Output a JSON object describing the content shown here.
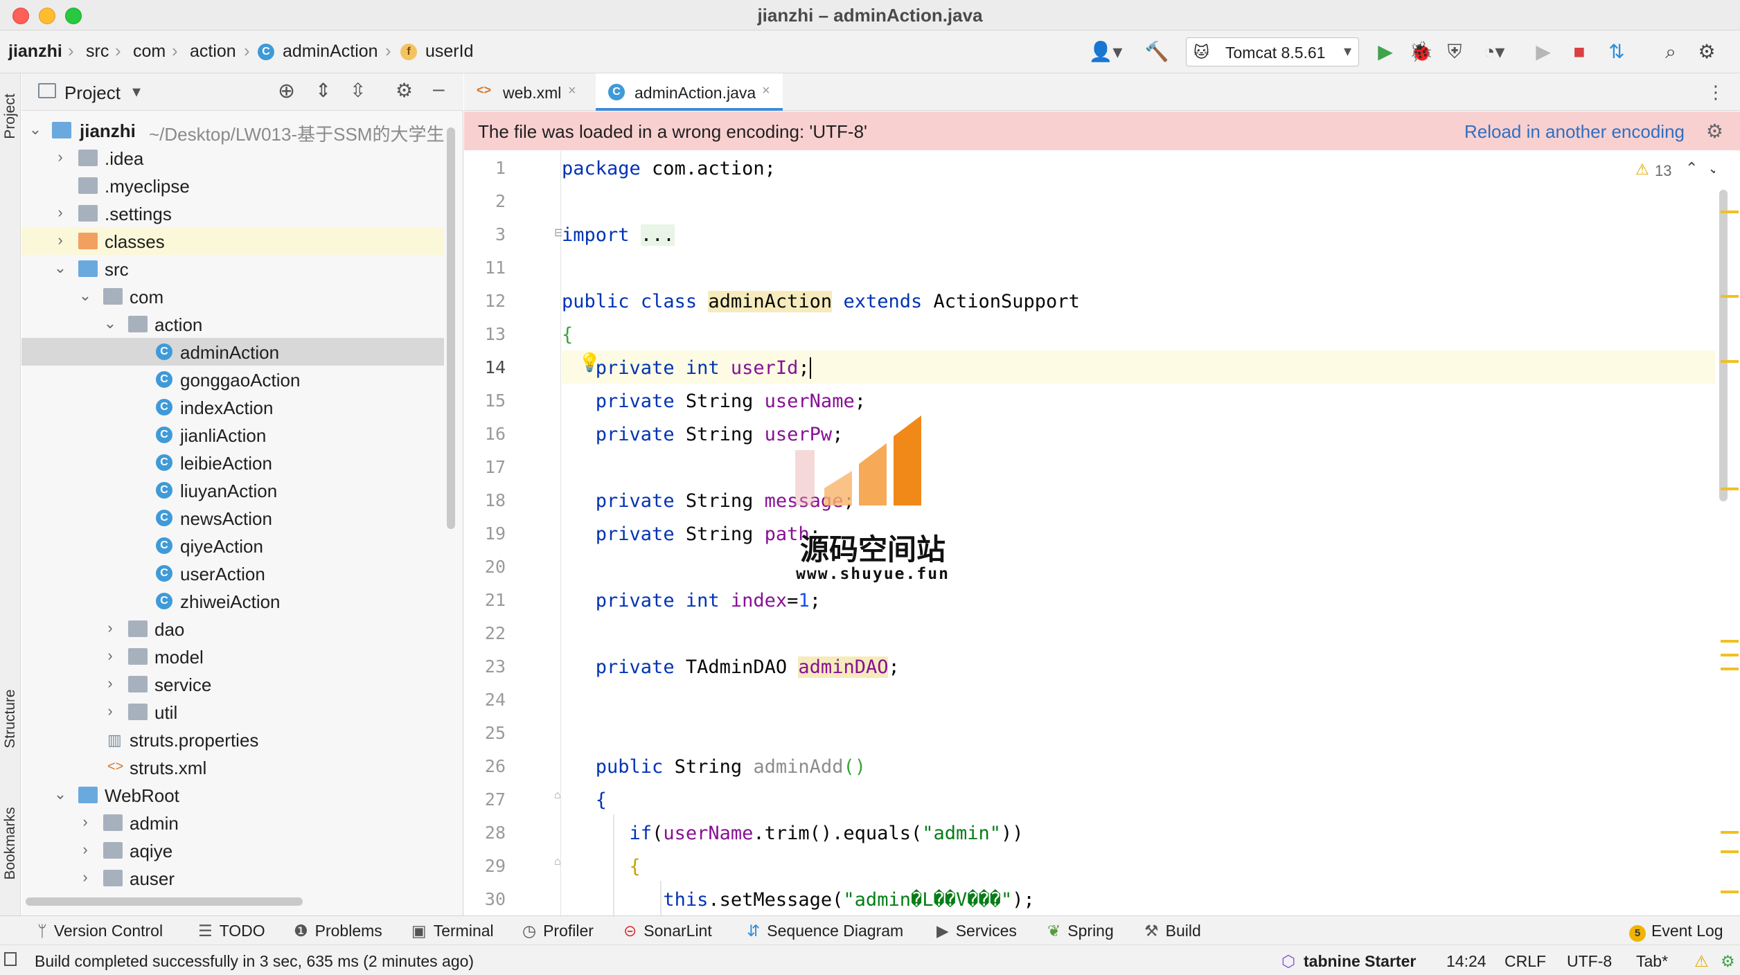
{
  "window": {
    "title": "jianzhi – adminAction.java"
  },
  "breadcrumbs": [
    {
      "label": "jianzhi"
    },
    {
      "label": "src"
    },
    {
      "label": "com"
    },
    {
      "label": "action"
    },
    {
      "label": "adminAction"
    },
    {
      "label": "userId"
    }
  ],
  "run_config": {
    "label": "Tomcat 8.5.61"
  },
  "project_panel": {
    "title": "Project",
    "root_label": "jianzhi",
    "root_path": "~/Desktop/LW013-基于SSM的大学生",
    "tree": [
      {
        "label": ".idea"
      },
      {
        "label": ".myeclipse"
      },
      {
        "label": ".settings"
      },
      {
        "label": "classes"
      },
      {
        "label": "src"
      },
      {
        "label": "com"
      },
      {
        "label": "action"
      },
      {
        "label": "adminAction"
      },
      {
        "label": "gonggaoAction"
      },
      {
        "label": "indexAction"
      },
      {
        "label": "jianliAction"
      },
      {
        "label": "leibieAction"
      },
      {
        "label": "liuyanAction"
      },
      {
        "label": "newsAction"
      },
      {
        "label": "qiyeAction"
      },
      {
        "label": "userAction"
      },
      {
        "label": "zhiweiAction"
      },
      {
        "label": "dao"
      },
      {
        "label": "model"
      },
      {
        "label": "service"
      },
      {
        "label": "util"
      },
      {
        "label": "struts.properties"
      },
      {
        "label": "struts.xml"
      },
      {
        "label": "WebRoot"
      },
      {
        "label": "admin"
      },
      {
        "label": "aqiye"
      },
      {
        "label": "auser"
      }
    ]
  },
  "side_strip": {
    "project": "Project",
    "structure": "Structure",
    "bookmarks": "Bookmarks"
  },
  "editor": {
    "tabs": [
      {
        "label": "web.xml"
      },
      {
        "label": "adminAction.java"
      }
    ],
    "banner": {
      "message": "The file was loaded in a wrong encoding: 'UTF-8'",
      "action": "Reload in another encoding"
    },
    "warnings_count": "13",
    "line_numbers": [
      "1",
      "2",
      "3",
      "11",
      "12",
      "13",
      "14",
      "15",
      "16",
      "17",
      "18",
      "19",
      "20",
      "21",
      "22",
      "23",
      "24",
      "25",
      "26",
      "27",
      "28",
      "29",
      "30"
    ],
    "code": {
      "l1_kw": "package",
      "l1_rest": " com.action;",
      "l3_kw": "import",
      "l3_fold": "...",
      "l12_kw1": "public",
      "l12_kw2": "class",
      "l12_name": "adminAction",
      "l12_kw3": "extends",
      "l12_rest": "ActionSupport",
      "l13": "{",
      "l14_kw1": "private",
      "l14_kw2": "int",
      "l14_fld": "userId",
      "l14_end": ";",
      "l15_kw": "private",
      "l15_type": "String",
      "l15_fld": "userName",
      "l15_end": ";",
      "l16_kw": "private",
      "l16_type": "String",
      "l16_fld": "userPw",
      "l16_end": ";",
      "l18_kw": "private",
      "l18_type": "String",
      "l18_fld": "message",
      "l18_end": ";",
      "l19_kw": "private",
      "l19_type": "String",
      "l19_fld": "path",
      "l19_end": ";",
      "l21_kw1": "private",
      "l21_kw2": "int",
      "l21_fld": "index",
      "l21_eq": "=",
      "l21_num": "1",
      "l21_end": ";",
      "l23_kw": "private",
      "l23_type": "TAdminDAO",
      "l23_fld": "adminDAO",
      "l23_end": ";",
      "l26_kw": "public",
      "l26_type": "String",
      "l26_mth": "adminAdd",
      "l26_end": "()",
      "l27": "{",
      "l28_kw": "if",
      "l28_a": "(",
      "l28_fld": "userName",
      "l28_b": ".trim().equals(",
      "l28_str": "\"admin\"",
      "l28_c": "))",
      "l29": "{",
      "l30_kw": "this",
      "l30_a": ".setMessage(",
      "l30_str": "\"admin�L��V���\"",
      "l30_b": ");"
    }
  },
  "watermark": {
    "title": "源码空间站",
    "url": "www.shuyue.fun"
  },
  "tool_windows": [
    {
      "label": "Version Control"
    },
    {
      "label": "TODO"
    },
    {
      "label": "Problems"
    },
    {
      "label": "Terminal"
    },
    {
      "label": "Profiler"
    },
    {
      "label": "SonarLint"
    },
    {
      "label": "Sequence Diagram"
    },
    {
      "label": "Services"
    },
    {
      "label": "Spring"
    },
    {
      "label": "Build"
    }
  ],
  "event_log": {
    "count": "5",
    "label": "Event Log"
  },
  "status": {
    "message": "Build completed successfully in 3 sec, 635 ms (2 minutes ago)",
    "tabnine": "tabnine Starter",
    "position": "14:24",
    "line_sep": "CRLF",
    "encoding": "UTF-8",
    "indent": "Tab*"
  },
  "colors": {
    "accent": "#3f9ad8",
    "banner_bg": "#f9d0d0",
    "link": "#2f6fc1",
    "keyword": "#0033b3",
    "field": "#871094",
    "string": "#067d17"
  }
}
